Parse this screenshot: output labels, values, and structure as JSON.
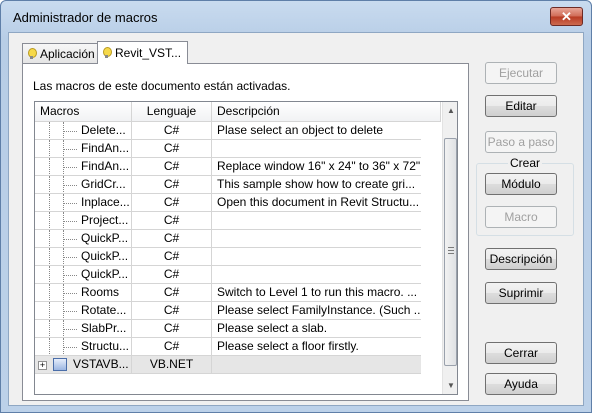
{
  "window": {
    "title": "Administrador de macros",
    "close_glyph": "✕"
  },
  "tabs": [
    {
      "label": "Aplicación",
      "icon": "lightbulb-icon"
    },
    {
      "label": "Revit_VST...",
      "icon": "lightbulb-icon"
    }
  ],
  "info_text": "Las macros de este documento están activadas.",
  "grid": {
    "headers": [
      "Macros",
      "Lenguaje",
      "Descripción"
    ],
    "rows": [
      {
        "name": "Delete...",
        "language": "C#",
        "description": "Plase select an object to delete"
      },
      {
        "name": "FindAn...",
        "language": "C#",
        "description": ""
      },
      {
        "name": "FindAn...",
        "language": "C#",
        "description": "Replace window 16\" x 24\" to 36\" x 72\""
      },
      {
        "name": "GridCr...",
        "language": "C#",
        "description": "This sample show how to create gri..."
      },
      {
        "name": "Inplace...",
        "language": "C#",
        "description": "Open this document in Revit Structu..."
      },
      {
        "name": "Project...",
        "language": "C#",
        "description": ""
      },
      {
        "name": "QuickP...",
        "language": "C#",
        "description": ""
      },
      {
        "name": "QuickP...",
        "language": "C#",
        "description": ""
      },
      {
        "name": "QuickP...",
        "language": "C#",
        "description": ""
      },
      {
        "name": "Rooms",
        "language": "C#",
        "description": "Switch to Level 1 to run this macro. ..."
      },
      {
        "name": "Rotate...",
        "language": "C#",
        "description": "Please select FamilyInstance. (Such ..."
      },
      {
        "name": "SlabPr...",
        "language": "C#",
        "description": "Please select a slab."
      },
      {
        "name": "Structu...",
        "language": "C#",
        "description": "Please select a floor firstly."
      }
    ],
    "group_row": {
      "expander": "+",
      "name": "VSTAVB...",
      "language": "VB.NET",
      "description": ""
    }
  },
  "buttons": {
    "ejecutar": "Ejecutar",
    "editar": "Editar",
    "paso_a_paso": "Paso a paso",
    "crear_group": "Crear",
    "modulo": "Módulo",
    "macro": "Macro",
    "descripcion": "Descripción",
    "suprimir": "Suprimir",
    "cerrar": "Cerrar",
    "ayuda": "Ayuda"
  },
  "scrollbar": {
    "up_glyph": "▲",
    "down_glyph": "▼"
  }
}
